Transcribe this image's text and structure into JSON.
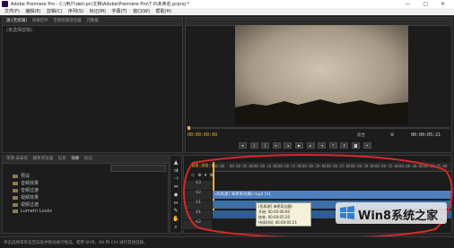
{
  "window": {
    "title": "Adobe Premiere Pro - C:\\用户\\dell-pc\\文档\\Adobe\\Premiere Pro\\7.0\\未命名.prproj *"
  },
  "menu": [
    "文件(F)",
    "编辑(E)",
    "剪辑(C)",
    "序列(S)",
    "标记(M)",
    "字幕(T)",
    "窗口(W)",
    "帮助(H)"
  ],
  "source_panel": {
    "tabs": [
      "源:(无剪辑)",
      "效果控件",
      "音频剪辑混合器",
      "元数据"
    ],
    "content": "(未选择剪辑)"
  },
  "program_monitor": {
    "timecode_left": "00:00:00:00",
    "fit_label": "适合",
    "timecode_right": "00:00:05:21"
  },
  "effects_panel": {
    "tabs": [
      "项目:未命名",
      "媒体浏览器",
      "信息",
      "效果",
      "标记"
    ],
    "folders": [
      "预设",
      "音频效果",
      "音频过渡",
      "视频效果",
      "视频过渡",
      "Lumetri Looks"
    ]
  },
  "timeline": {
    "timecode": "00:00:00:00",
    "ruler": [
      "00:00",
      "00:00:05:00",
      "00:00:10:00",
      "00:00:15:00",
      "00:00:20:00",
      "00:00:25:00",
      "00:00:30:00",
      "00:00:35:00",
      "00:00:40:00",
      "00:00:45:00"
    ],
    "tracks": [
      "V3",
      "V2",
      "V1",
      "A1",
      "A2"
    ],
    "clip_label": "[吊具源] 海枣奇达跟) mp4 [V]",
    "tooltip": {
      "title": "[吊具源] 海枣奇达跟)",
      "start": "开始: 00:00:00:00",
      "end": "结束: 00:00:05:20",
      "duration": "持续时间: 00:00:05:21"
    }
  },
  "status_bar": "单击选择或单击空白处并拖动进行框选。使用 Shift、Alt 和 Ctrl 进行其他选择。",
  "watermark": "Win8系统之家",
  "colors": {
    "accent": "#3c7fc4",
    "highlight_circle": "#d32a2a",
    "timecode": "#f0b23a"
  }
}
